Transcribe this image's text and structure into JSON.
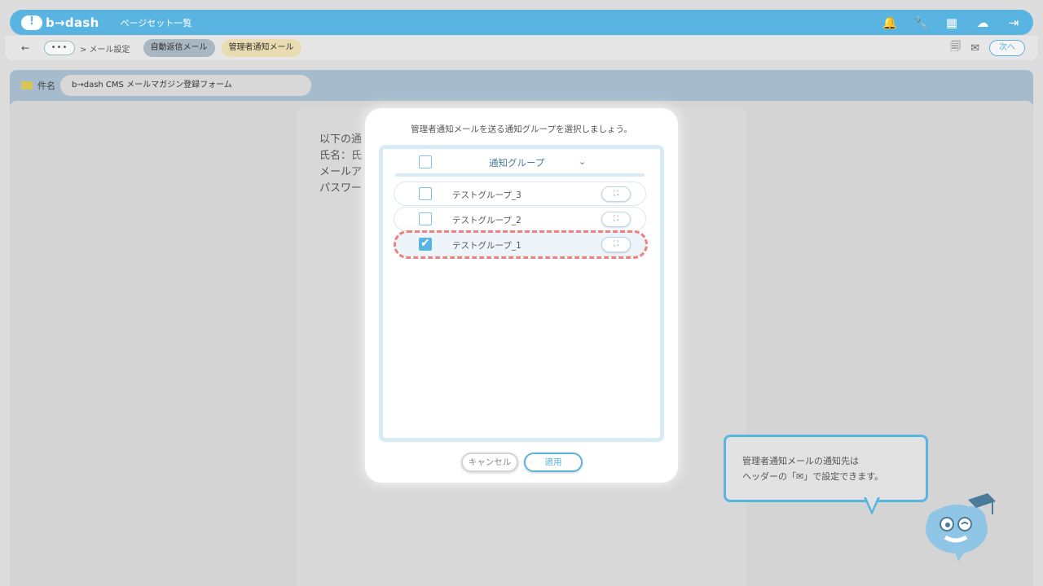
{
  "header": {
    "logo_text": "b→dash",
    "page_name": "ページセット一覧",
    "icons": [
      "bell-icon",
      "wrench-icon",
      "apps-grid-icon",
      "support-icon",
      "logout-icon"
    ]
  },
  "subbar": {
    "more": "•••",
    "crumb": "> メール設定",
    "tabs": [
      "自動返信メール",
      "管理者通知メール"
    ],
    "next_label": "次へ"
  },
  "subject": {
    "label": "件名",
    "value": "b→dash CMS メールマガジン登録フォーム"
  },
  "document": {
    "lines": [
      "以下の通",
      "氏名：氏",
      "メールア",
      "パスワー"
    ]
  },
  "modal": {
    "title": "管理者通知メールを送る通知グループを選択しましょう。",
    "column_label": "通知グループ",
    "rows": [
      {
        "label": "テストグループ_3",
        "checked": false
      },
      {
        "label": "テストグループ_2",
        "checked": false
      },
      {
        "label": "テストグループ_1",
        "checked": true
      }
    ],
    "expand_glyph": "⛶",
    "cancel_label": "キャンセル",
    "apply_label": "適用"
  },
  "tooltip": {
    "line1": "管理者通知メールの通知先は",
    "line2": "ヘッダーの「✉」で設定できます。"
  },
  "colors": {
    "brand": "#5ab4e2",
    "highlight": "#f08080",
    "tab_active": "#e8dcb0"
  }
}
